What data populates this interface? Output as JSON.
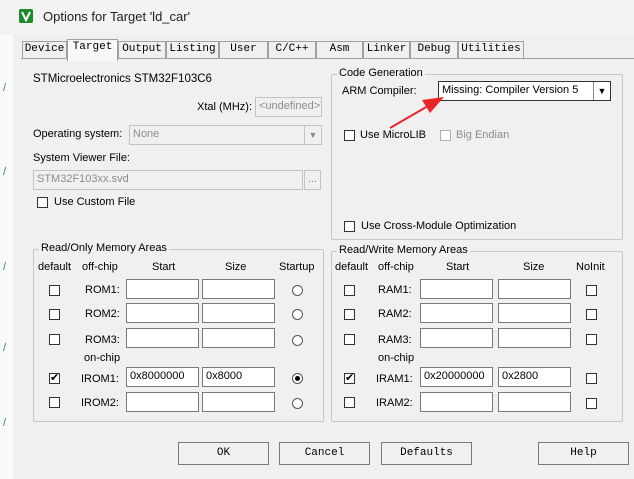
{
  "window": {
    "title": "Options for Target 'ld_car'"
  },
  "tabs": [
    {
      "label": "Device"
    },
    {
      "label": "Target"
    },
    {
      "label": "Output"
    },
    {
      "label": "Listing"
    },
    {
      "label": "User"
    },
    {
      "label": "C/C++"
    },
    {
      "label": "Asm"
    },
    {
      "label": "Linker"
    },
    {
      "label": "Debug"
    },
    {
      "label": "Utilities"
    }
  ],
  "device": {
    "name": "STMicroelectronics STM32F103C6",
    "xtal_label": "Xtal (MHz):",
    "xtal_value": "<undefined>",
    "os_label": "Operating system:",
    "os_value": "None",
    "svd_label": "System Viewer File:",
    "svd_value": "STM32F103xx.svd",
    "browse_label": "...",
    "custom_file_label": "Use Custom File"
  },
  "codegen": {
    "title": "Code Generation",
    "compiler_label": "ARM Compiler:",
    "compiler_value": "Missing: Compiler Version 5",
    "microlib_label": "Use MicroLIB",
    "big_endian_label": "Big Endian",
    "cross_module_label": "Use Cross-Module Optimization"
  },
  "rom_areas": {
    "title": "Read/Only Memory Areas",
    "headers": {
      "default": "default",
      "offchip": "off-chip",
      "start": "Start",
      "size": "Size",
      "startup": "Startup"
    },
    "onchip_label": "on-chip",
    "rows": [
      {
        "name": "ROM1:",
        "start": "",
        "size": "",
        "default": false,
        "startup": false
      },
      {
        "name": "ROM2:",
        "start": "",
        "size": "",
        "default": false,
        "startup": false
      },
      {
        "name": "ROM3:",
        "start": "",
        "size": "",
        "default": false,
        "startup": false
      },
      {
        "name": "IROM1:",
        "start": "0x8000000",
        "size": "0x8000",
        "default": true,
        "startup": true
      },
      {
        "name": "IROM2:",
        "start": "",
        "size": "",
        "default": false,
        "startup": false
      }
    ]
  },
  "ram_areas": {
    "title": "Read/Write Memory Areas",
    "headers": {
      "default": "default",
      "offchip": "off-chip",
      "start": "Start",
      "size": "Size",
      "noinit": "NoInit"
    },
    "onchip_label": "on-chip",
    "rows": [
      {
        "name": "RAM1:",
        "start": "",
        "size": "",
        "default": false,
        "noinit": false
      },
      {
        "name": "RAM2:",
        "start": "",
        "size": "",
        "default": false,
        "noinit": false
      },
      {
        "name": "RAM3:",
        "start": "",
        "size": "",
        "default": false,
        "noinit": false
      },
      {
        "name": "IRAM1:",
        "start": "0x20000000",
        "size": "0x2800",
        "default": true,
        "noinit": false
      },
      {
        "name": "IRAM2:",
        "start": "",
        "size": "",
        "default": false,
        "noinit": false
      }
    ]
  },
  "buttons": {
    "ok": "OK",
    "cancel": "Cancel",
    "defaults": "Defaults",
    "help": "Help"
  },
  "colors": {
    "annotation_arrow": "#e8262a",
    "app_icon": "#1f8a2a"
  }
}
